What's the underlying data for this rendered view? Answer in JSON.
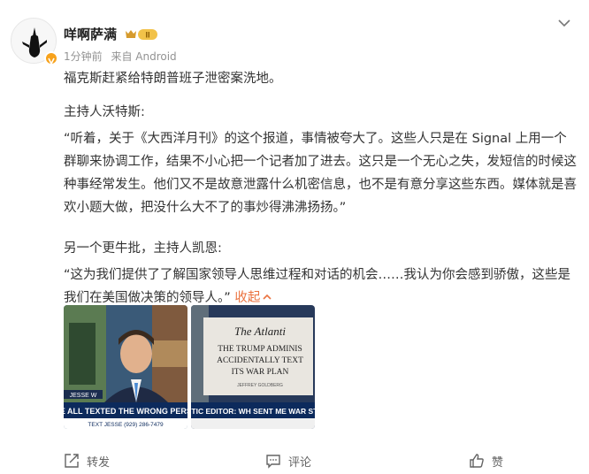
{
  "post": {
    "username": "咩啊萨满",
    "vip_level": "II",
    "time": "1分钟前",
    "source": "来自 Android",
    "paragraphs": [
      "福克斯赶紧给特朗普班子泄密案洗地。",
      "主持人沃特斯:",
      "“听着，关于《大西洋月刊》的这个报道，事情被夸大了。这些人只是在 Signal 上用一个群聊来协调工作，结果不小心把一个记者加了进去。这只是一个无心之失，发短信的时候这种事经常发生。他们又不是故意泄露什么机密信息，也不是有意分享这些东西。媒体就是喜欢小题大做，把没什么大不了的事炒得沸沸扬扬。”",
      "另一个更牛批，主持人凯恩:"
    ],
    "last_paragraph": "“这为我们提供了了解国家领导人思维过程和对话的机会……我认为你会感到骄傲，这些是我们在美国做决策的领导人。”",
    "collapse_label": "收起"
  },
  "images": [
    {
      "caption": "E'VE ALL TEXTED THE WRONG PERSON",
      "ticker": "TEXT JESSE (929) 286-7479",
      "name_tag": "JESSE W"
    },
    {
      "headline": "The Atlanti",
      "line1": "THE TRUMP ADMINIS",
      "line2": "ACCIDENTALLY TEXT",
      "line3": "ITS WAR PLAN",
      "byline": "JEFFREY GOLDBERG",
      "caption": "ANTIC EDITOR: WH SENT ME WAR STRI"
    }
  ],
  "actions": {
    "repost_label": "转发",
    "comment_label": "评论",
    "like_label": "赞"
  },
  "colors": {
    "accent": "#eb7340",
    "verified": "#f7a21c",
    "text": "#333333",
    "meta": "#939393"
  }
}
